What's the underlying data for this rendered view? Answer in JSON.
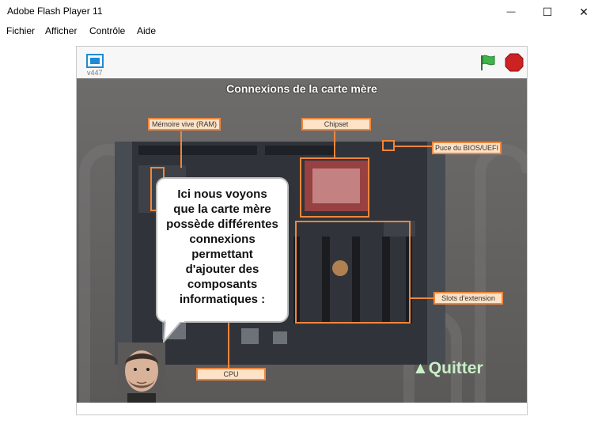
{
  "window": {
    "title": "Adobe Flash Player 11",
    "controls": {
      "minimize": "—",
      "maximize": "☐",
      "close": "✕"
    }
  },
  "menu": {
    "items": [
      {
        "label": "Fichier"
      },
      {
        "label": "Afficher"
      },
      {
        "label": "Contrôle"
      },
      {
        "label": "Aide"
      }
    ]
  },
  "player": {
    "version": "v447",
    "icons": {
      "fullscreen": "fullscreen-icon",
      "green_flag": "green-flag-icon",
      "stop": "stop-icon"
    },
    "colors": {
      "flag": "#3cb54a",
      "stop": "#cc2222",
      "fullscreen": "#1e8ad6"
    }
  },
  "stage": {
    "title": "Connexions de la carte mère",
    "callouts": {
      "ram": "Mémoire vive (RAM)",
      "chipset": "Chipset",
      "bios": "Puce du BIOS/UEFI",
      "slots": "Slots d'extension",
      "cpu": "CPU"
    },
    "bubble_lines": [
      "Ici nous voyons",
      "que la carte mère",
      "possède différentes",
      "connexions",
      "permettant",
      "d'ajouter des",
      "composants",
      "informatiques :"
    ],
    "quit_label": "▲Quitter",
    "accent_color": "#f0863c"
  }
}
